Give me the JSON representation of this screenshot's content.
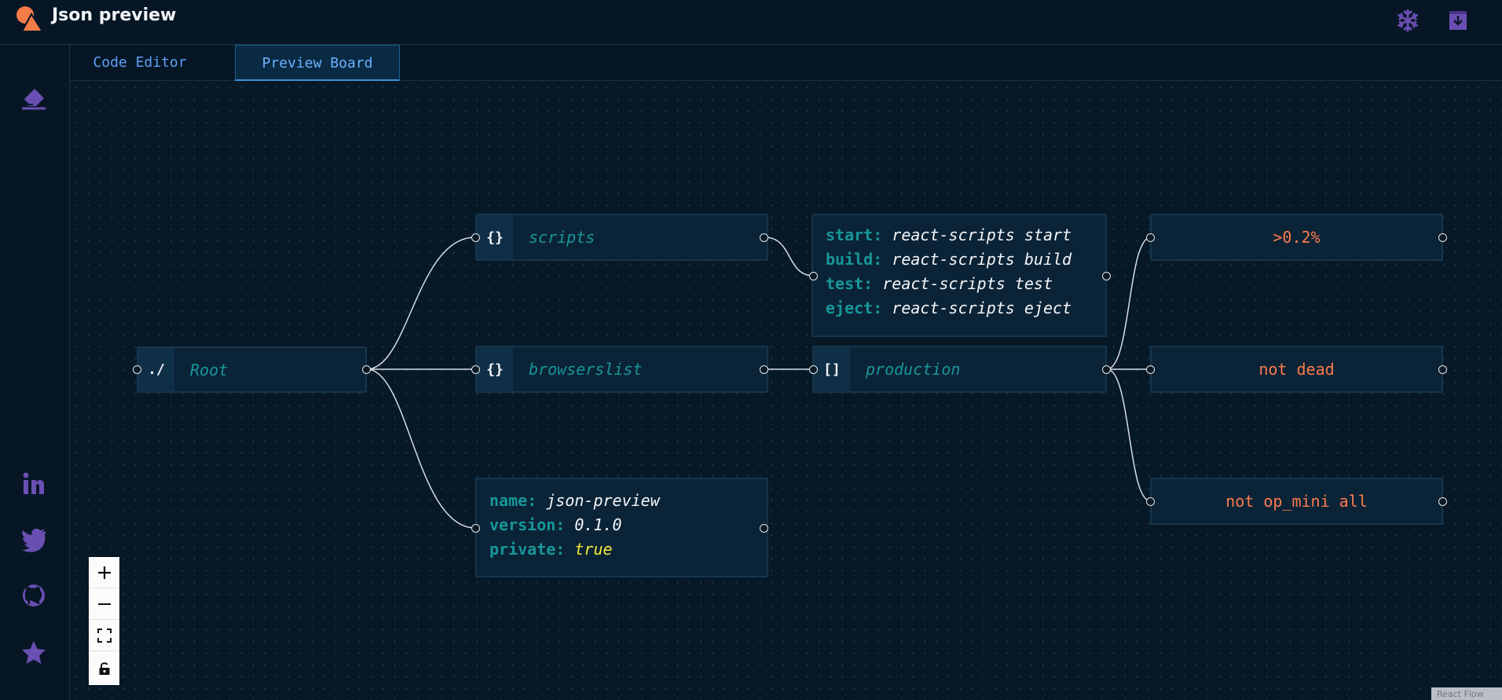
{
  "app": {
    "title": "Json preview"
  },
  "header": {
    "icons": [
      "snowflake-icon",
      "download-icon"
    ]
  },
  "tabs": [
    {
      "label": "Code Editor",
      "active": false
    },
    {
      "label": "Preview Board",
      "active": true
    }
  ],
  "sidebar": {
    "icons": [
      "eraser-icon",
      "linkedin-icon",
      "twitter-icon",
      "github-icon",
      "star-icon"
    ]
  },
  "nodes": {
    "root": {
      "icon": "./",
      "label": "Root"
    },
    "scripts": {
      "icon": "{}",
      "label": "scripts"
    },
    "browserslist": {
      "icon": "{}",
      "label": "browserslist"
    },
    "production": {
      "icon": "[]",
      "label": "production"
    },
    "scripts_values": [
      {
        "key": "start:",
        "value": "react-scripts start"
      },
      {
        "key": "build:",
        "value": "react-scripts build"
      },
      {
        "key": "test:",
        "value": "react-scripts test"
      },
      {
        "key": "eject:",
        "value": "react-scripts eject"
      }
    ],
    "root_values": [
      {
        "key": "name:",
        "value": "json-preview"
      },
      {
        "key": "version:",
        "value": "0.1.0"
      },
      {
        "key": "private:",
        "value": "true"
      }
    ],
    "production_items": [
      ">0.2%",
      "not dead",
      "not op_mini all"
    ]
  },
  "controls": [
    "zoom-in-icon",
    "zoom-out-icon",
    "fit-view-icon",
    "lock-icon"
  ],
  "attribution": "React Flow",
  "colors": {
    "background": "#071827",
    "accent": "#5ea0f5",
    "key": "#17979a",
    "leaf": "#fb7a4d",
    "boolean": "#f2ea3a",
    "icon": "#6a4fb3"
  }
}
